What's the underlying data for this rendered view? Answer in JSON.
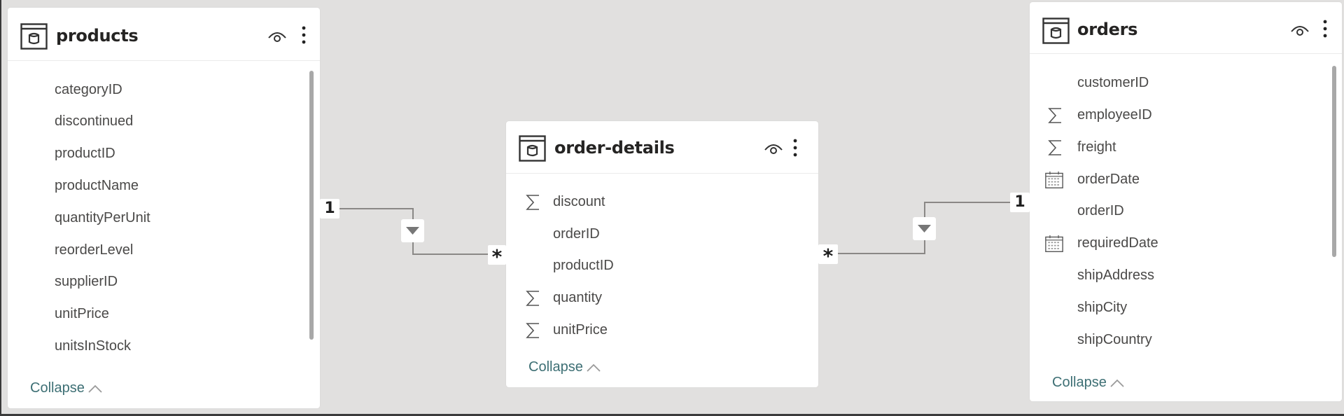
{
  "tables": {
    "products": {
      "title": "products",
      "fields": [
        {
          "name": "categoryID",
          "icon": "none"
        },
        {
          "name": "discontinued",
          "icon": "none"
        },
        {
          "name": "productID",
          "icon": "none"
        },
        {
          "name": "productName",
          "icon": "none"
        },
        {
          "name": "quantityPerUnit",
          "icon": "none"
        },
        {
          "name": "reorderLevel",
          "icon": "none"
        },
        {
          "name": "supplierID",
          "icon": "none"
        },
        {
          "name": "unitPrice",
          "icon": "none"
        },
        {
          "name": "unitsInStock",
          "icon": "none"
        }
      ],
      "collapse_label": "Collapse"
    },
    "order_details": {
      "title": "order-details",
      "fields": [
        {
          "name": "discount",
          "icon": "sigma-icon"
        },
        {
          "name": "orderID",
          "icon": "none"
        },
        {
          "name": "productID",
          "icon": "none"
        },
        {
          "name": "quantity",
          "icon": "sigma-icon"
        },
        {
          "name": "unitPrice",
          "icon": "sigma-icon"
        }
      ],
      "collapse_label": "Collapse"
    },
    "orders": {
      "title": "orders",
      "fields": [
        {
          "name": "customerID",
          "icon": "none"
        },
        {
          "name": "employeeID",
          "icon": "sigma-icon"
        },
        {
          "name": "freight",
          "icon": "sigma-icon"
        },
        {
          "name": "orderDate",
          "icon": "calendar-icon"
        },
        {
          "name": "orderID",
          "icon": "none"
        },
        {
          "name": "requiredDate",
          "icon": "calendar-icon"
        },
        {
          "name": "shipAddress",
          "icon": "none"
        },
        {
          "name": "shipCity",
          "icon": "none"
        },
        {
          "name": "shipCountry",
          "icon": "none"
        }
      ],
      "collapse_label": "Collapse"
    }
  },
  "relationships": [
    {
      "from": "products",
      "to": "order-details",
      "from_cardinality": "1",
      "to_cardinality": "*",
      "filter_direction": "single"
    },
    {
      "from": "orders",
      "to": "order-details",
      "from_cardinality": "1",
      "to_cardinality": "*",
      "filter_direction": "single"
    }
  ],
  "colors": {
    "canvas": "#e1e0df",
    "card": "#ffffff",
    "title_text": "#252423",
    "field_text": "#4a4948",
    "collapse_text": "#3d6f74",
    "connector": "#8a8886"
  }
}
